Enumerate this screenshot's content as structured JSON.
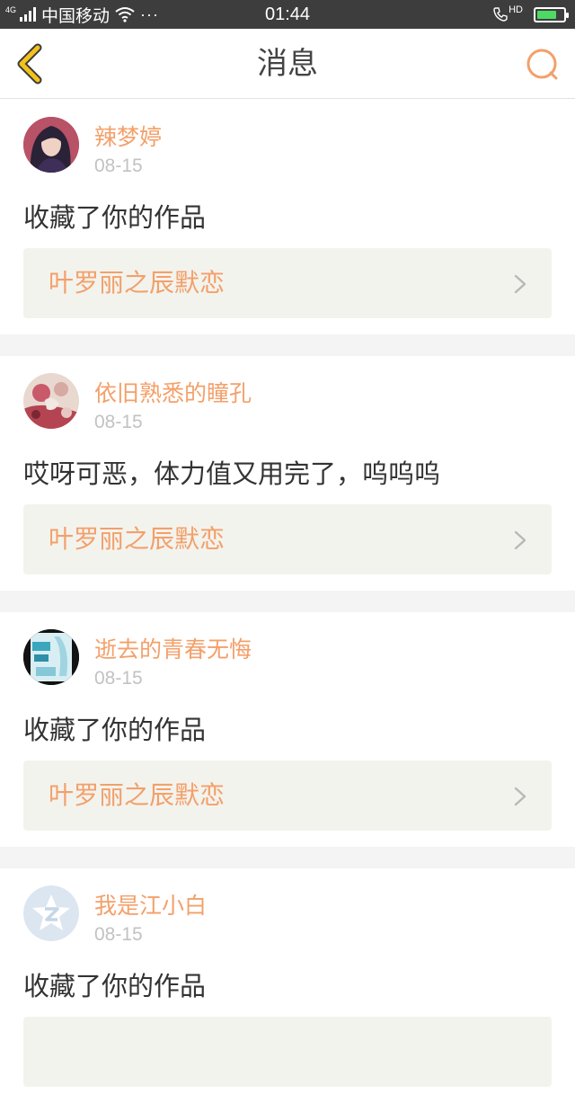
{
  "status_bar": {
    "network": "4G",
    "carrier": "中国移动",
    "dots": "···",
    "time": "01:44",
    "hd": "HD",
    "battery_level": 0.75
  },
  "nav": {
    "title": "消息"
  },
  "colors": {
    "accent": "#f3a06a",
    "back_arrow": "#f2c21b",
    "card_link_bg": "#f3f3ee",
    "status_bar_bg": "#3d3d3d"
  },
  "messages": [
    {
      "username": "辣梦婷",
      "date": "08-15",
      "text": "收藏了你的作品",
      "work": "叶罗丽之辰默恋"
    },
    {
      "username": "依旧熟悉的瞳孔",
      "date": "08-15",
      "text": "哎呀可恶，体力值又用完了，呜呜呜",
      "work": "叶罗丽之辰默恋"
    },
    {
      "username": "逝去的青春无悔",
      "date": "08-15",
      "text": "收藏了你的作品",
      "work": "叶罗丽之辰默恋"
    },
    {
      "username": "我是江小白",
      "date": "08-15",
      "text": "收藏了你的作品",
      "work": ""
    }
  ]
}
